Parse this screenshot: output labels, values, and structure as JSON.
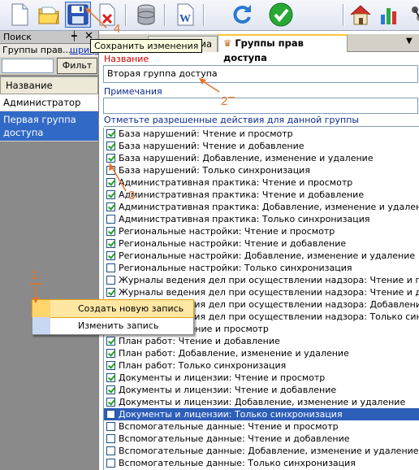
{
  "toolbar": {
    "tooltip": "Сохранить изменения"
  },
  "left_panel": {
    "title": "Поиск",
    "tab_groups": "Группы прав...",
    "tab_fonts": "шрифт",
    "filter_button": "Фильт",
    "list_header": "Название",
    "items": [
      {
        "label": "Администратор"
      },
      {
        "label": "Первая группа доступа"
      }
    ]
  },
  "context_menu": {
    "items": [
      {
        "label": "Создать новую запись"
      },
      {
        "label": "Изменить запись"
      }
    ]
  },
  "main": {
    "tabs": [
      {
        "label": "орма"
      },
      {
        "label": "Группы прав доступа"
      }
    ],
    "name_label": "Название",
    "name_value": "Вторая группа доступа",
    "notes_label": "Примечания",
    "notes_value": "",
    "permissions_label": "Отметьте разрешенные действия для данной группы",
    "permissions": [
      {
        "label": "База нарушений: Чтение и просмотр",
        "checked": true
      },
      {
        "label": "База нарушений: Чтение и добавление",
        "checked": true
      },
      {
        "label": "База нарушений: Добавление, изменение и удаление",
        "checked": true
      },
      {
        "label": "База нарушений: Только синхронизация",
        "checked": false
      },
      {
        "label": "Административная практика: Чтение и просмотр",
        "checked": true
      },
      {
        "label": "Административная практика: Чтение и добавление",
        "checked": true
      },
      {
        "label": "Административная практика: Добавление, изменение и удаление",
        "checked": true
      },
      {
        "label": "Административная практика: Только синхронизация",
        "checked": false
      },
      {
        "label": "Региональные настройки: Чтение и просмотр",
        "checked": true
      },
      {
        "label": "Региональные настройки: Чтение и добавление",
        "checked": true
      },
      {
        "label": "Региональные настройки: Добавление, изменение и удаление",
        "checked": true
      },
      {
        "label": "Региональные настройки: Только синхронизация",
        "checked": false
      },
      {
        "label": "Журналы ведения дел при осуществлении надзора: Чтение и просмотр",
        "checked": false
      },
      {
        "label": "Журналы ведения дел при осуществлении надзора: Чтение и добавлени",
        "checked": true
      },
      {
        "label": "Журналы ведения дел при осуществлении надзора: Добавление, измен",
        "checked": true
      },
      {
        "label": "Журналы ведения дел при осуществлении надзора: Только синхрониза",
        "checked": false
      },
      {
        "label": "План работ: Чтение и просмотр",
        "checked": true
      },
      {
        "label": "План работ: Чтение и добавление",
        "checked": true
      },
      {
        "label": "План работ: Добавление, изменение и удаление",
        "checked": true
      },
      {
        "label": "План работ: Только синхронизация",
        "checked": true
      },
      {
        "label": "Документы и лицензии: Чтение и просмотр",
        "checked": true
      },
      {
        "label": "Документы и лицензии: Чтение и добавление",
        "checked": true
      },
      {
        "label": "Документы и лицензии: Добавление, изменение и удаление",
        "checked": true
      },
      {
        "label": "Документы и лицензии: Только синхронизация",
        "checked": false,
        "selected": true
      },
      {
        "label": "Вспомогательные данные: Чтение и просмотр",
        "checked": false
      },
      {
        "label": "Вспомогательные данные: Чтение и добавление",
        "checked": false
      },
      {
        "label": "Вспомогательные данные: Добавление, изменение и удаление",
        "checked": false
      },
      {
        "label": "Вспомогательные данные: Только синхронизация",
        "checked": false
      }
    ]
  },
  "annotations": [
    "1",
    "2",
    "3",
    "4"
  ]
}
